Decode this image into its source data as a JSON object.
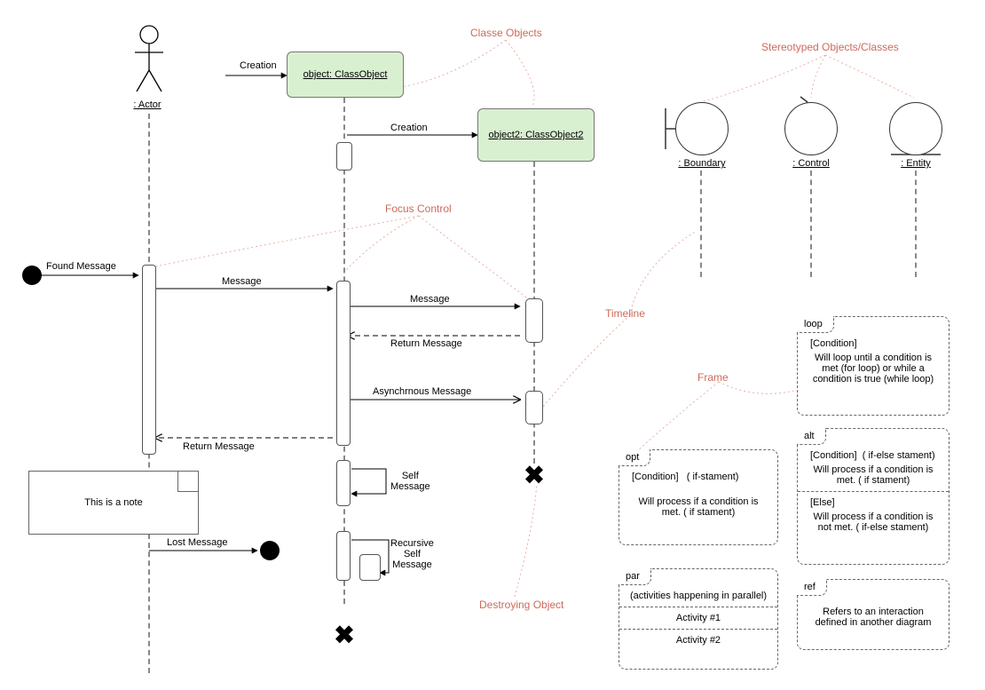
{
  "actor": {
    "label": ": Actor"
  },
  "objects": {
    "obj1": "object: ClassObject",
    "obj2": "object2: ClassObject2"
  },
  "stereotypes": {
    "title": "Stereotyped Objects/Classes",
    "boundary": ": Boundary",
    "control": ": Control",
    "entity": ": Entity"
  },
  "messages": {
    "creation1": "Creation",
    "creation2": "Creation",
    "found": "Found Message",
    "msg1": "Message",
    "msg2": "Message",
    "return1": "Return Message",
    "async": "Asynchrnous Message",
    "return2": "Return Message",
    "self": "Self\nMessage",
    "recursive": "Recursive\nSelf\nMessage",
    "lost": "Lost Message"
  },
  "annotations": {
    "classe": "Classe Objects",
    "focus": "Focus Control",
    "timeline": "Timeline",
    "frame": "Frame",
    "destroy": "Destroying Object"
  },
  "note": "This is a note",
  "frames": {
    "loop": {
      "tag": "loop",
      "cond": "[Condition]",
      "body": "Will loop until a condition is met (for loop) or while a condition is true (while loop)"
    },
    "opt": {
      "tag": "opt",
      "cond": "[Condition]",
      "hint": "( if-stament)",
      "body": "Will process if a condition is met. ( if stament)"
    },
    "alt": {
      "tag": "alt",
      "cond": "[Condition]",
      "hint": "( if-else stament)",
      "body1": "Will process if a condition is met. ( if stament)",
      "else": "[Else]",
      "body2": "Will process if a condition is not met. ( if-else stament)"
    },
    "par": {
      "tag": "par",
      "head": "(activities happening in parallel)",
      "a1": "Activity #1",
      "a2": "Activity #2"
    },
    "ref": {
      "tag": "ref",
      "body": "Refers to an interaction defined in another diagram"
    }
  }
}
